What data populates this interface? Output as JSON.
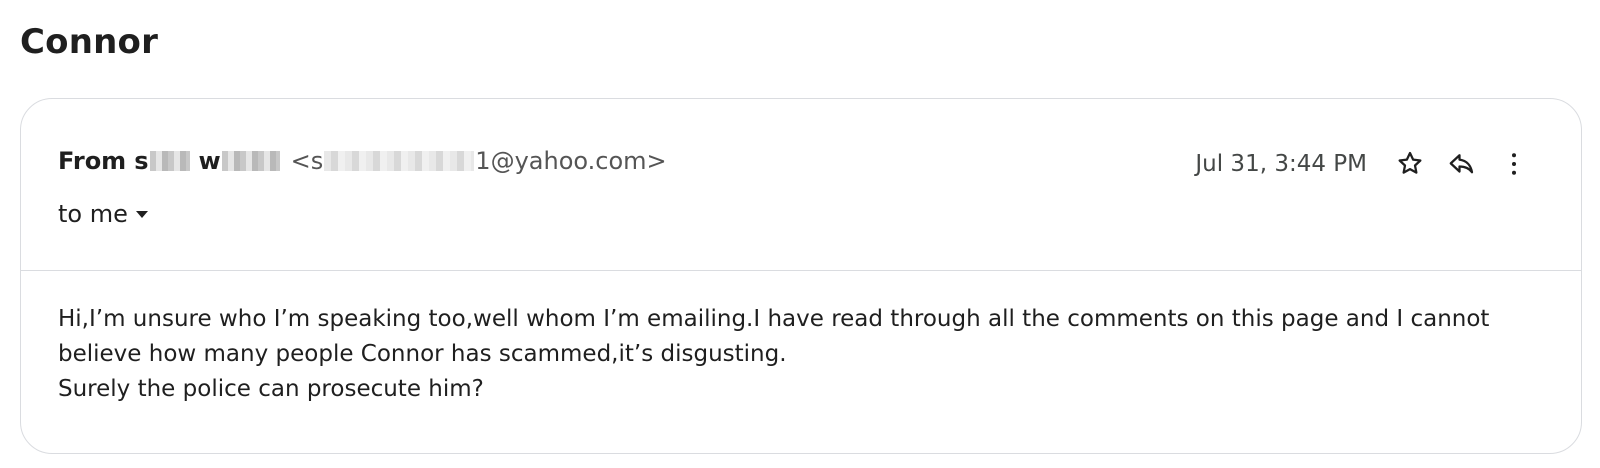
{
  "page": {
    "title": "Connor"
  },
  "email": {
    "from_label": "From",
    "sender_name_initial_1": "s",
    "sender_name_initial_2": "w",
    "sender_email_prefix": "<s",
    "sender_email_suffix": "1@yahoo.com>",
    "to_label": "to me",
    "date": "Jul 31, 3:44 PM",
    "body_lines": [
      "Hi,I’m unsure who I’m speaking too,well whom I’m emailing.I have read through all the comments on this page and I cannot",
      "believe how many people Connor has scammed,it’s disgusting.",
      "Surely the police can prosecute him?"
    ]
  },
  "icons": {
    "star": "star-icon",
    "reply": "reply-icon",
    "more": "more-vert-icon",
    "dropdown": "caret-down-icon"
  },
  "colors": {
    "text": "#1f1f1f",
    "secondary_text": "#444746",
    "border": "#dadce0"
  }
}
